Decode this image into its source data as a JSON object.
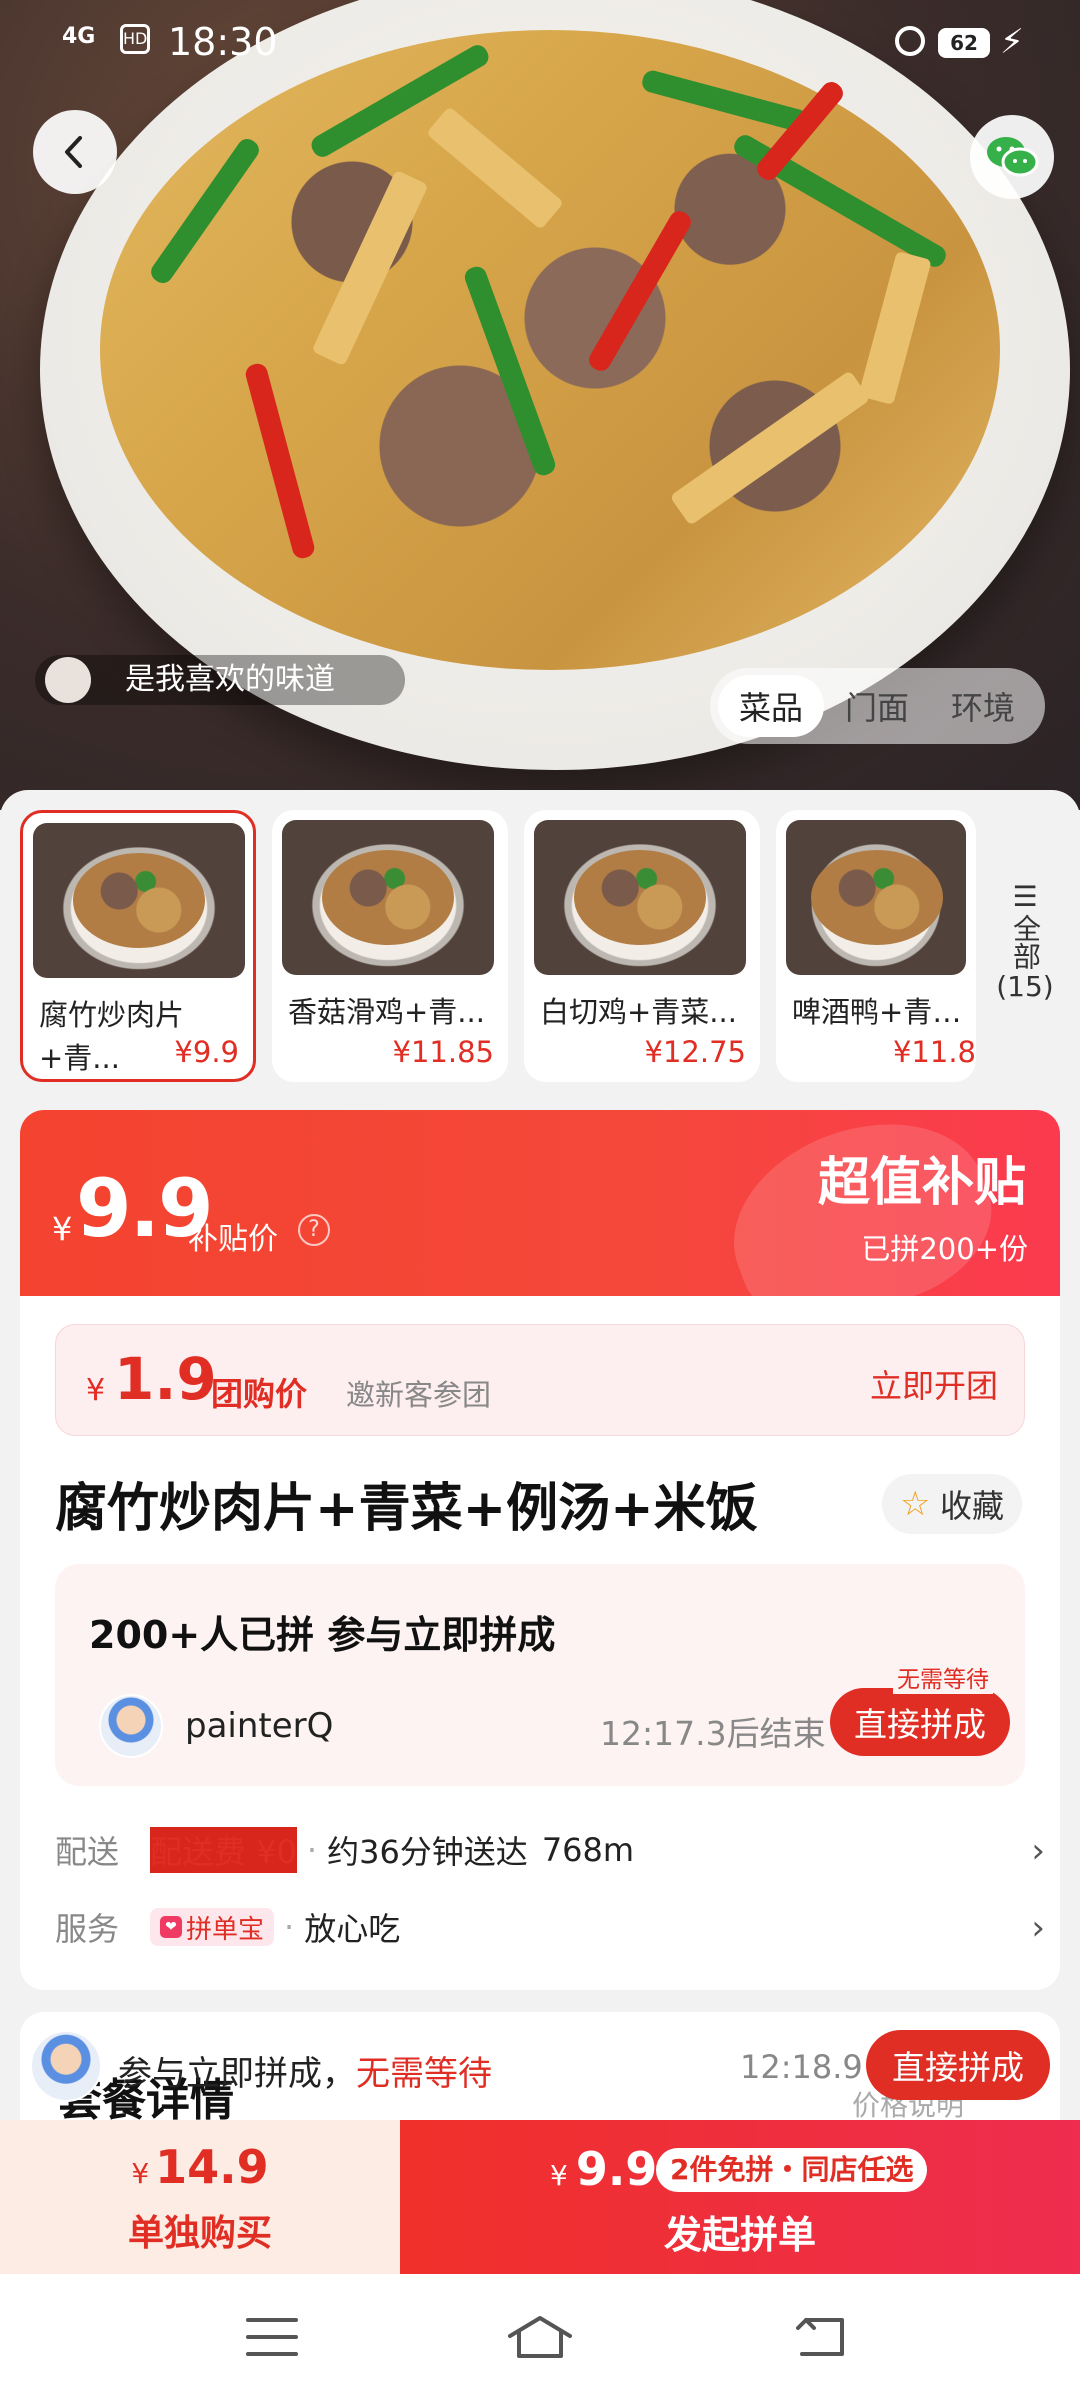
{
  "status_bar": {
    "network": "4G",
    "hd": "HD",
    "time": "18:30",
    "battery": "62"
  },
  "hero": {
    "caption": "是我喜欢的味道",
    "tabs": [
      {
        "label": "菜品",
        "active": true
      },
      {
        "label": "门面",
        "active": false
      },
      {
        "label": "环境",
        "active": false
      }
    ]
  },
  "thumbnails": {
    "items": [
      {
        "name": "腐竹炒肉片",
        "name2": "+青...",
        "price": "¥9.9",
        "selected": true
      },
      {
        "name": "香菇滑鸡+青...",
        "price": "¥11.85"
      },
      {
        "name": "白切鸡+青菜...",
        "price": "¥12.75"
      },
      {
        "name": "啤酒鸭+青菜...",
        "price": "¥11.8"
      }
    ],
    "all_label": "全部",
    "all_count": "(15)"
  },
  "price_banner": {
    "currency": "¥",
    "price": "9.9",
    "label": "补贴价",
    "help": "?",
    "title": "超值补贴",
    "sold": "已拼200+份"
  },
  "group_buy": {
    "currency": "¥",
    "price": "1.9",
    "label": "团购价",
    "note": "邀新客参团",
    "action": "立即开团"
  },
  "product": {
    "title": "腐竹炒肉片+青菜+例汤+米饭",
    "favorite": "收藏"
  },
  "join": {
    "title": "200+人已拼 参与立即拼成",
    "user": "painterQ",
    "countdown": "12:17.3后结束",
    "tag": "无需等待",
    "button": "直接拼成"
  },
  "delivery": {
    "label": "配送",
    "fee": "配送费 ¥0",
    "eta": "约36分钟送达",
    "distance": "768m"
  },
  "service": {
    "label": "服务",
    "badge": "拼单宝",
    "text": "放心吃"
  },
  "package": {
    "heading": "套餐详情",
    "right": "价格说明"
  },
  "ticker": {
    "text": "参与立即拼成，",
    "highlight": "无需等待",
    "time": "12:18.9",
    "button": "直接拼成"
  },
  "buybar": {
    "solo": {
      "currency": "¥",
      "price": "14.9",
      "label": "单独购买"
    },
    "group": {
      "currency": "¥",
      "price": "9.9",
      "tag": "2件免拼・同店任选",
      "label": "发起拼单"
    }
  },
  "colors": {
    "accent": "#e02e24",
    "banner": "#f4432f"
  },
  "icons": [
    "back-arrow-icon",
    "wechat-icon",
    "star-icon",
    "help-icon",
    "chevron-right-icon",
    "menu-icon",
    "home-icon",
    "back-icon"
  ]
}
